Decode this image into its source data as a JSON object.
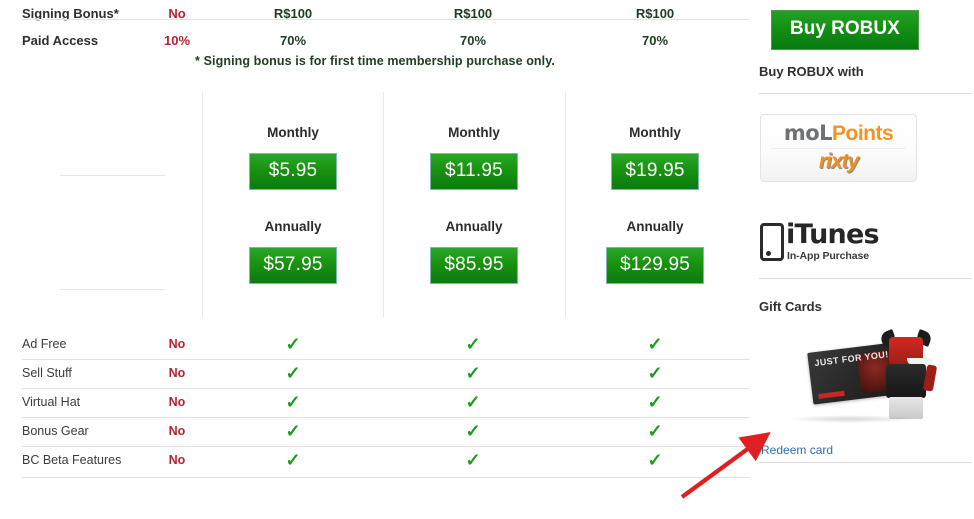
{
  "comparison": {
    "rows": [
      {
        "label": "Signing Bonus*",
        "free": "No",
        "bc": "R$100",
        "tbc": "R$100",
        "obc": "R$100"
      },
      {
        "label": "Paid Access",
        "free": "10%",
        "bc": "70%",
        "tbc": "70%",
        "obc": "70%"
      }
    ],
    "footnote": "* Signing bonus is for first time membership purchase only."
  },
  "pricing": {
    "monthly_label": "Monthly",
    "annually_label": "Annually",
    "columns": [
      {
        "monthly": "",
        "annually": ""
      },
      {
        "monthly": "$5.95",
        "annually": "$57.95"
      },
      {
        "monthly": "$11.95",
        "annually": "$85.95"
      },
      {
        "monthly": "$19.95",
        "annually": "$129.95"
      }
    ]
  },
  "features": {
    "rows": [
      {
        "label": "Ad Free",
        "free": "No",
        "bc": "✓",
        "tbc": "✓",
        "obc": "✓"
      },
      {
        "label": "Sell Stuff",
        "free": "No",
        "bc": "✓",
        "tbc": "✓",
        "obc": "✓"
      },
      {
        "label": "Virtual Hat",
        "free": "No",
        "bc": "✓",
        "tbc": "✓",
        "obc": "✓"
      },
      {
        "label": "Bonus Gear",
        "free": "No",
        "bc": "✓",
        "tbc": "✓",
        "obc": "✓"
      },
      {
        "label": "BC Beta Features",
        "free": "No",
        "bc": "✓",
        "tbc": "✓",
        "obc": "✓"
      }
    ]
  },
  "sidebar": {
    "buy_robux_label": "Buy ROBUX",
    "buy_with_heading": "Buy ROBUX with",
    "mol_prefix": "moL",
    "mol_suffix": "Points",
    "rixty_label": "rixty",
    "itunes_label": "iTunes",
    "itunes_sub": "In-App Purchase",
    "gift_cards_heading": "Gift Cards",
    "gift_card_text": "JUST FOR YOU!",
    "redeem_label": "Redeem card"
  },
  "colors": {
    "green_button": "#19920f",
    "red_no": "#b8232f",
    "check_green": "#1c9c1c",
    "link_blue": "#2d6ea8",
    "footnote_green": "#1f4023",
    "annotation_red": "#e02020",
    "mol_orange": "#f39323",
    "mol_gray": "#6f7275"
  },
  "annotation": {
    "type": "arrow",
    "points_to": "Redeem card"
  }
}
